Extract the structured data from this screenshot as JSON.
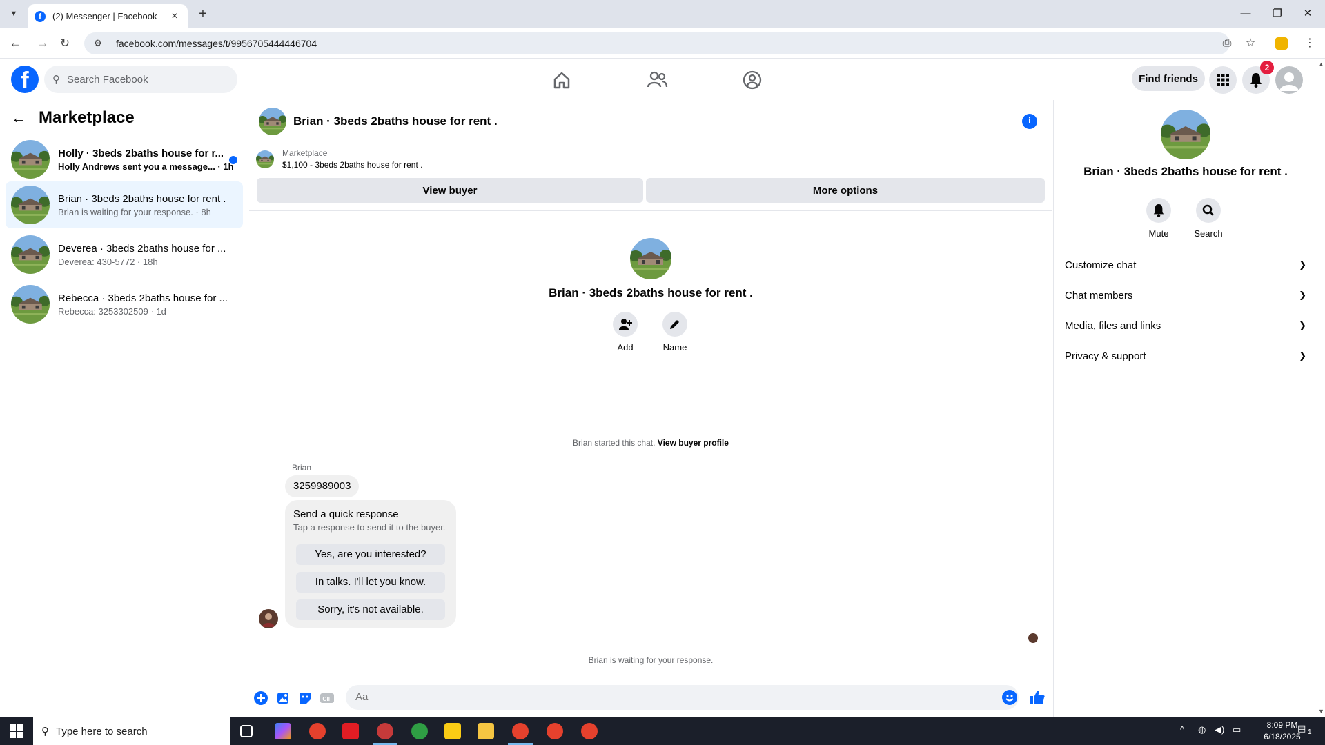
{
  "browser": {
    "tab_title": "(2) Messenger | Facebook",
    "url": "facebook.com/messages/t/9956705444446704"
  },
  "fb": {
    "search_placeholder": "Search Facebook",
    "find_friends": "Find friends",
    "notification_count": "2"
  },
  "sidebar": {
    "title": "Marketplace",
    "conversations": [
      {
        "name": "Holly · 3beds 2baths house for r...",
        "preview": "Holly Andrews sent you a message... · 1h",
        "unread": true
      },
      {
        "name": "Brian · 3beds 2baths house for rent .",
        "preview": "Brian is waiting for your response. · 8h",
        "unread": false
      },
      {
        "name": "Deverea · 3beds 2baths house for ...",
        "preview": "Deverea: 430-5772 · 18h",
        "unread": false
      },
      {
        "name": "Rebecca · 3beds 2baths house for ...",
        "preview": "Rebecca: 3253302509 · 1d",
        "unread": false
      }
    ]
  },
  "chat": {
    "title": "Brian · 3beds 2baths house for rent .",
    "marketplace_label": "Marketplace",
    "listing": "$1,100 - 3beds 2baths house for rent .",
    "view_buyer": "View buyer",
    "more_options": "More options",
    "profile_name": "Brian · 3beds 2baths house for rent .",
    "add_label": "Add",
    "name_label": "Name",
    "started_text": "Brian started this chat.",
    "view_buyer_profile": "View buyer profile",
    "sender": "Brian",
    "message": "3259989003",
    "quick_title": "Send a quick response",
    "quick_subtitle": "Tap a response to send it to the buyer.",
    "quick_responses": [
      "Yes, are you interested?",
      "In talks. I'll let you know.",
      "Sorry, it's not available."
    ],
    "waiting_text": "Brian is waiting for your response.",
    "composer_placeholder": "Aa"
  },
  "panel": {
    "name": "Brian · 3beds 2baths house for rent .",
    "mute": "Mute",
    "search": "Search",
    "sections": [
      "Customize chat",
      "Chat members",
      "Media, files and links",
      "Privacy & support"
    ]
  },
  "taskbar": {
    "search_placeholder": "Type here to search",
    "time": "8:09 PM",
    "date": "6/18/2025",
    "notification_count": "1"
  },
  "colors": {
    "fb_blue": "#0866ff",
    "active_conv": "#ebf5ff",
    "badge_red": "#e41e3f"
  }
}
